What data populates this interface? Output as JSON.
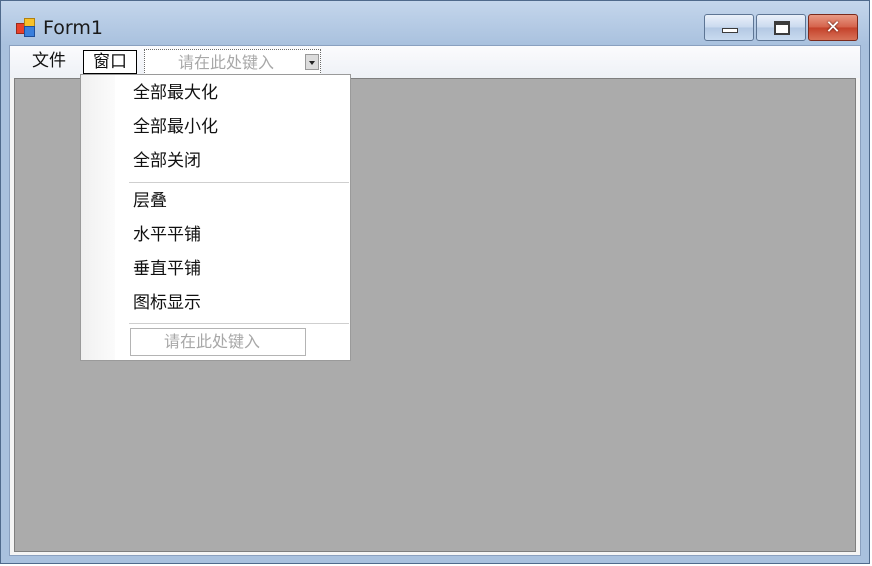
{
  "window": {
    "title": "Form1",
    "controls": {
      "minimize": "minimize-icon",
      "maximize": "maximize-icon",
      "close": "✕"
    }
  },
  "menubar": {
    "items": [
      {
        "label": "文件"
      },
      {
        "label": "窗口"
      }
    ],
    "type_here_placeholder": "请在此处键入"
  },
  "dropdown": {
    "items": [
      {
        "label": "全部最大化"
      },
      {
        "label": "全部最小化"
      },
      {
        "label": "全部关闭"
      },
      {
        "label": "层叠"
      },
      {
        "label": "水平平铺"
      },
      {
        "label": "垂直平铺"
      },
      {
        "label": "图标显示"
      }
    ],
    "type_here_placeholder": "请在此处键入"
  }
}
